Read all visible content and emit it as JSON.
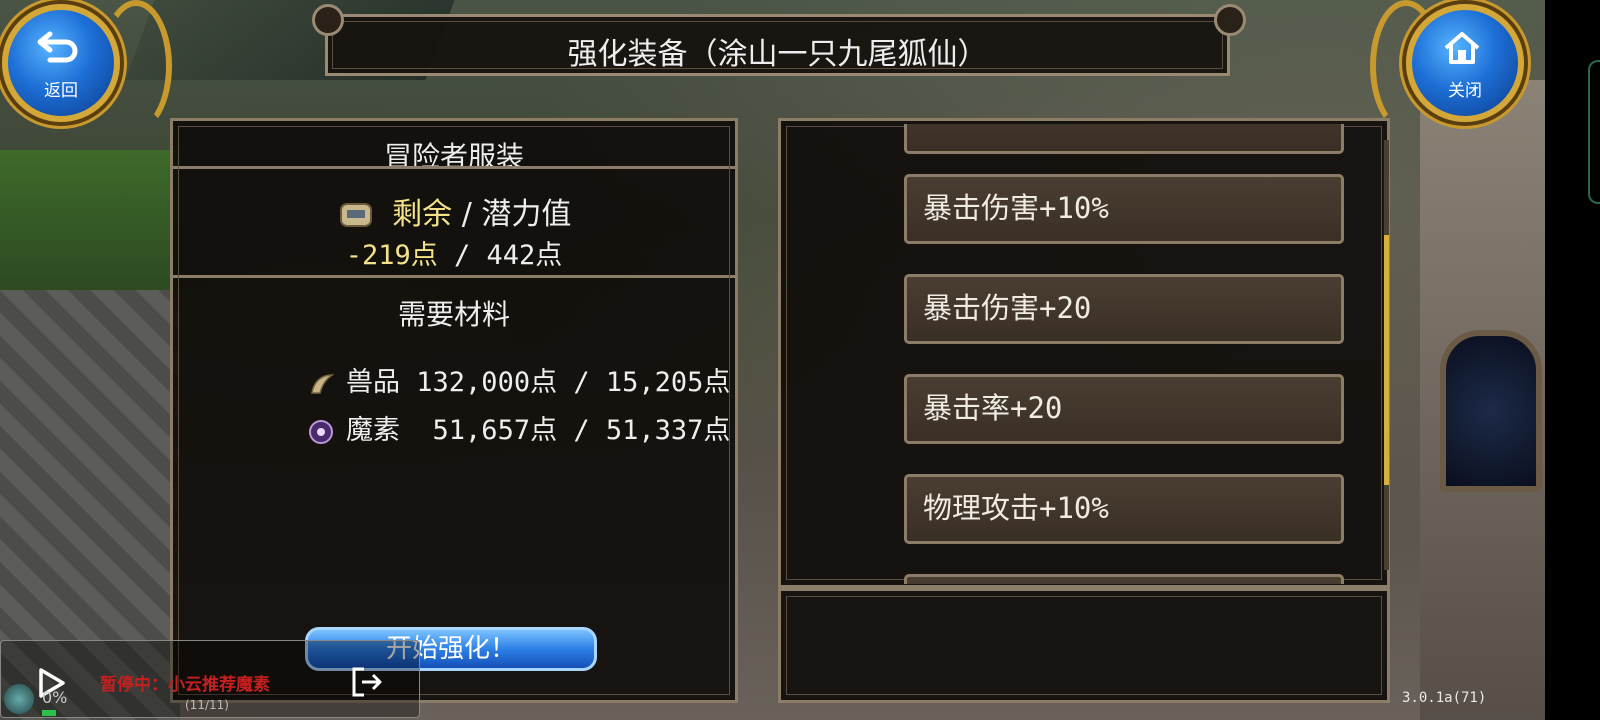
{
  "title": "强化装备（涂山一只九尾狐仙）",
  "back_button": {
    "label": "返回",
    "icon": "back-arrow-icon"
  },
  "close_button": {
    "label": "关闭",
    "icon": "home-icon"
  },
  "left_panel": {
    "title": "冒险者服装",
    "potential": {
      "label_remaining": "剩余",
      "separator": " / ",
      "label_potential": "潜力值",
      "remaining_value": "-219点",
      "slash": " / ",
      "potential_value": "442点"
    },
    "materials_title": "需要材料",
    "materials": [
      {
        "icon": "claw-icon",
        "name": "兽品",
        "text": " 132,000点 / 15,205点"
      },
      {
        "icon": "purple-orb-icon",
        "name": "魔素",
        "text": "  51,657点 / 51,337点"
      }
    ]
  },
  "start_button": {
    "label": "开始强化！"
  },
  "options": [
    {
      "label": "暴击伤害+10%"
    },
    {
      "label": "暴击伤害+20"
    },
    {
      "label": "暴击率+20"
    },
    {
      "label": "物理攻击+10%"
    }
  ],
  "overlay": {
    "percent": "0%",
    "paused_text": "暂停中：小云推荐魔素",
    "counter": "(11/11)"
  },
  "version": "3.0.1a(71)",
  "colors": {
    "accent_yellow": "#f4e28a",
    "button_blue": "#2d80e6",
    "frame": "#8c7d68",
    "gold": "#d4a838"
  }
}
